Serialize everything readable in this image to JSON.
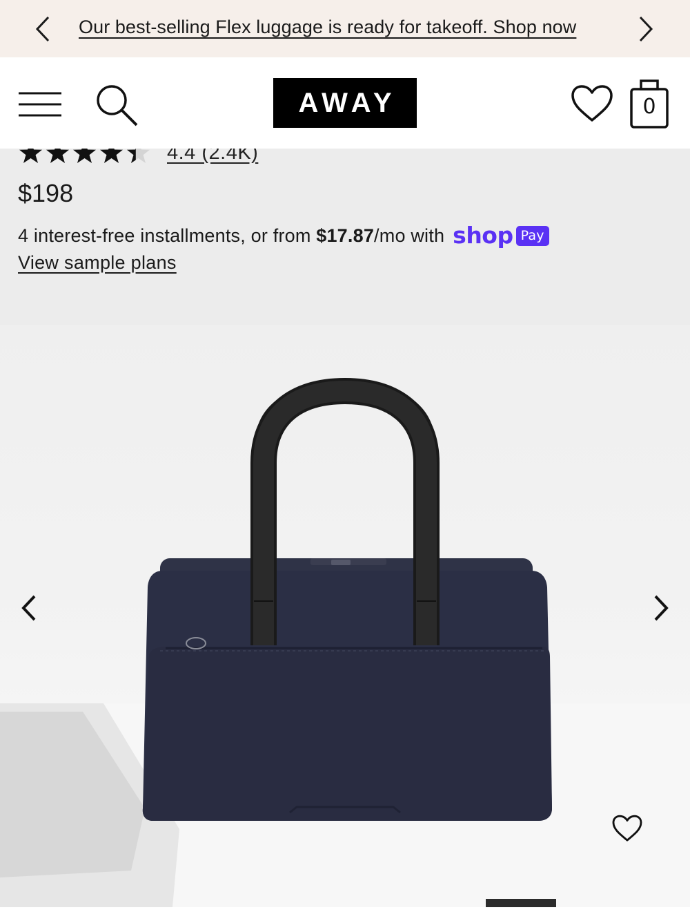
{
  "announcement": {
    "message": "Our best-selling Flex luggage is ready for takeoff. Shop now",
    "prev_icon": "chevron-left-icon",
    "next_icon": "chevron-right-icon"
  },
  "header": {
    "logo": "AWAY",
    "menu_icon": "hamburger-menu-icon",
    "search_icon": "search-icon",
    "wishlist_icon": "heart-icon",
    "cart_icon": "shopping-bag-icon",
    "cart_count": "0"
  },
  "product": {
    "rating_value": 4.4,
    "rating_max": 5,
    "rating_text": "4.4 (2.4K)",
    "price": "$198",
    "installments_prefix": "4 interest-free installments, or from ",
    "installment_amount": "$17.87",
    "installments_suffix": "/mo with",
    "shop_pay_word": "shop",
    "shop_pay_badge": "Pay",
    "sample_plans_link": "View sample plans"
  },
  "gallery": {
    "image_alt": "navy-duffel-bag-image",
    "prev_icon": "chevron-left-icon",
    "next_icon": "chevron-right-icon",
    "favorite_icon": "heart-icon"
  },
  "colors": {
    "announcement_bg": "#f6efea",
    "info_bg": "#ececec",
    "shop_pay_purple": "#5a31f4",
    "bag_navy": "#2b2f45"
  }
}
